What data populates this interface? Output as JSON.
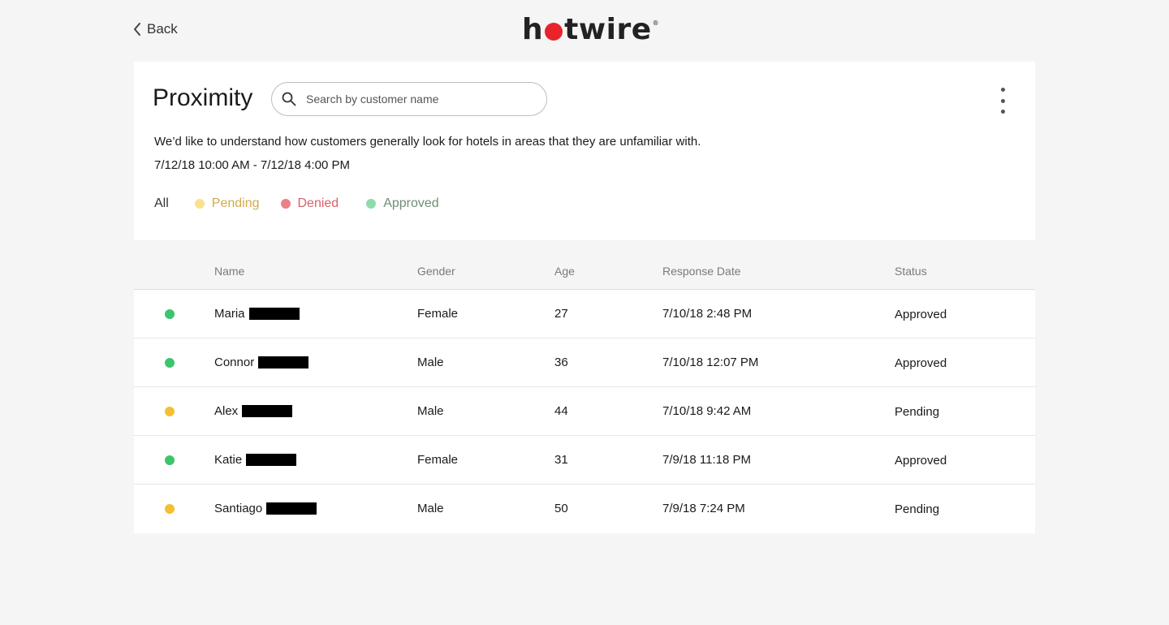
{
  "nav": {
    "back_label": "Back",
    "logo_text_left": "h",
    "logo_text_right": "twire",
    "logo_reg": "®",
    "brand_color": "#e8232a"
  },
  "header": {
    "title": "Proximity",
    "search_placeholder": "Search by customer name",
    "search_value": "",
    "description": "We’d like to understand how customers generally look for hotels in areas that they are unfamiliar with.",
    "date_range": "7/12/18 10:00 AM - 7/12/18 4:00 PM"
  },
  "filters": {
    "all": "All",
    "pending": "Pending",
    "denied": "Denied",
    "approved": "Approved",
    "colors": {
      "pending": "#fbe08e",
      "denied": "#ec8086",
      "approved": "#8fdcaa"
    }
  },
  "table": {
    "columns": {
      "name": "Name",
      "gender": "Gender",
      "age": "Age",
      "response_date": "Response Date",
      "status": "Status"
    },
    "rows": [
      {
        "name": "Maria",
        "gender": "Female",
        "age": "27",
        "response_date": "7/10/18 2:48 PM",
        "status": "Approved",
        "status_key": "approved"
      },
      {
        "name": "Connor",
        "gender": "Male",
        "age": "36",
        "response_date": "7/10/18 12:07 PM",
        "status": "Approved",
        "status_key": "approved"
      },
      {
        "name": "Alex",
        "gender": "Male",
        "age": "44",
        "response_date": "7/10/18 9:42 AM",
        "status": "Pending",
        "status_key": "pending"
      },
      {
        "name": "Katie",
        "gender": "Female",
        "age": "31",
        "response_date": "7/9/18 11:18 PM",
        "status": "Approved",
        "status_key": "approved"
      },
      {
        "name": "Santiago",
        "gender": "Male",
        "age": "50",
        "response_date": "7/9/18 7:24 PM",
        "status": "Pending",
        "status_key": "pending"
      }
    ],
    "status_colors": {
      "approved": "#3ec46d",
      "pending": "#f5bf2f"
    }
  }
}
